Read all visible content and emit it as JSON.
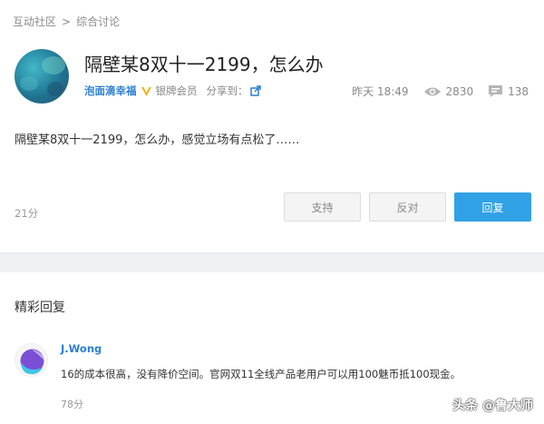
{
  "breadcrumb": {
    "root": "互动社区",
    "separator": ">",
    "current": "综合讨论"
  },
  "post": {
    "title": "隔壁某8双十一2199，怎么办",
    "author": "泡面滴幸福",
    "member_level": "银牌会员",
    "share_label": "分享到：",
    "time": "昨天 18:49",
    "views": "2830",
    "comments": "138",
    "content": "隔壁某8双十一2199，怎么办，感觉立场有点松了……",
    "score": "21分"
  },
  "actions": {
    "support": "支持",
    "oppose": "反对",
    "reply": "回复"
  },
  "highlight": {
    "section_title": "精彩回复",
    "reply": {
      "author": "J.Wong",
      "text": "16的成本很高，没有降价空间。官网双11全线产品老用户可以用100魅币抵100现金。",
      "score": "78分"
    }
  },
  "watermark": {
    "text": "头条 @鲁大师"
  },
  "colors": {
    "accent": "#31a1e6",
    "link": "#2b7fd0",
    "divider": "#eef1f4"
  }
}
